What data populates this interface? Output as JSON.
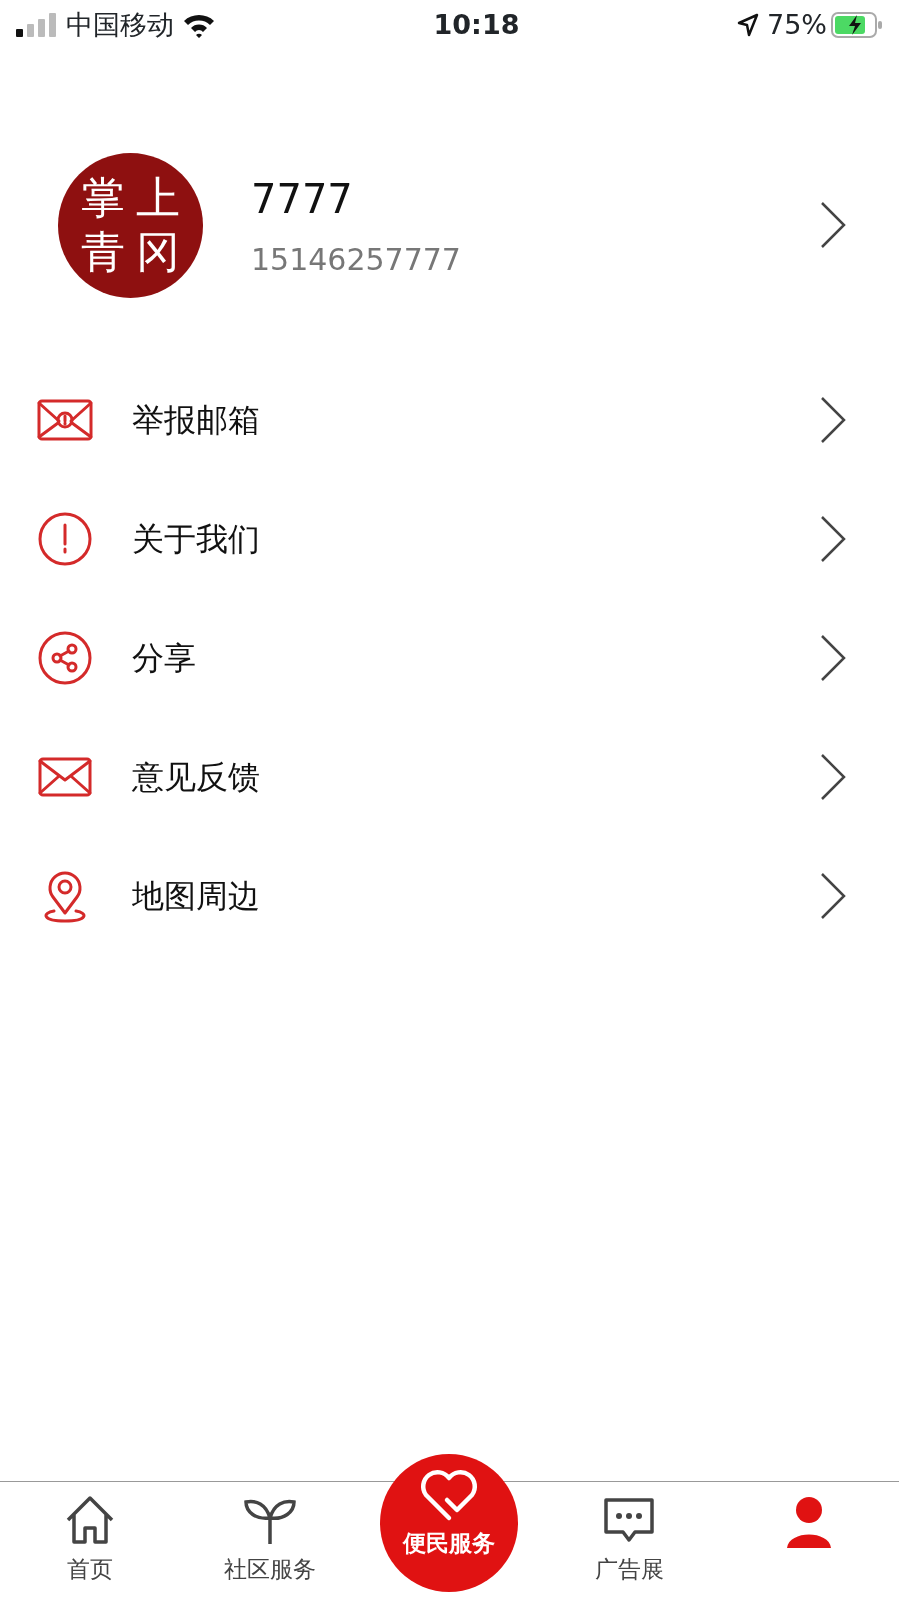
{
  "status_bar": {
    "carrier": "中国移动",
    "time": "10:18",
    "battery": "75%"
  },
  "profile": {
    "avatar_chars": [
      "掌",
      "上",
      "青",
      "冈"
    ],
    "name": "7777",
    "phone": "15146257777"
  },
  "menu": [
    {
      "kind": "report-mail",
      "label": "举报邮箱"
    },
    {
      "kind": "about",
      "label": "关于我们"
    },
    {
      "kind": "share",
      "label": "分享"
    },
    {
      "kind": "mail",
      "label": "意见反馈"
    },
    {
      "kind": "map",
      "label": "地图周边"
    }
  ],
  "tab_bar": [
    {
      "kind": "home",
      "label": "首页",
      "selected": false
    },
    {
      "kind": "sprout",
      "label": "社区服务",
      "selected": false
    },
    {
      "kind": "center",
      "label": "便民服务",
      "selected": false
    },
    {
      "kind": "chat",
      "label": "广告展",
      "selected": false
    },
    {
      "kind": "person",
      "selected": true
    }
  ]
}
